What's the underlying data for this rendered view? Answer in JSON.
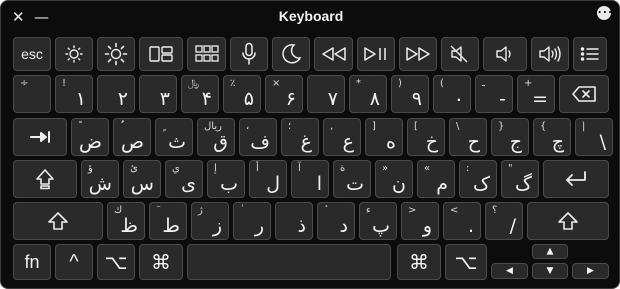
{
  "window": {
    "title": "Keyboard",
    "close_glyph": "✕",
    "minimize_glyph": "—",
    "options_glyph": "⋯"
  },
  "row0": [
    {
      "name": "esc-key",
      "label": "esc"
    },
    {
      "name": "brightness-down-key",
      "icon": "brightness-down-icon"
    },
    {
      "name": "brightness-up-key",
      "icon": "brightness-up-icon"
    },
    {
      "name": "mission-control-key",
      "icon": "mission-control-icon"
    },
    {
      "name": "launchpad-key",
      "icon": "launchpad-icon"
    },
    {
      "name": "dictation-key",
      "icon": "microphone-icon"
    },
    {
      "name": "do-not-disturb-key",
      "icon": "moon-icon"
    },
    {
      "name": "rewind-key",
      "icon": "rewind-icon"
    },
    {
      "name": "play-pause-key",
      "icon": "play-pause-icon"
    },
    {
      "name": "fast-forward-key",
      "icon": "fast-forward-icon"
    },
    {
      "name": "mute-key",
      "icon": "mute-icon"
    },
    {
      "name": "volume-down-key",
      "icon": "volume-down-icon"
    },
    {
      "name": "volume-up-key",
      "icon": "volume-up-icon"
    },
    {
      "name": "list-key",
      "icon": "list-icon"
    }
  ],
  "row1": [
    {
      "shift": "÷",
      "main": ""
    },
    {
      "shift": "!",
      "main": "١"
    },
    {
      "shift": "",
      "main": "٢"
    },
    {
      "shift": "",
      "main": "٣"
    },
    {
      "shift": "﷼",
      "main": "۴"
    },
    {
      "shift": "٪",
      "main": "۵"
    },
    {
      "shift": "×",
      "main": "۶"
    },
    {
      "shift": "",
      "main": "۷"
    },
    {
      "shift": "*",
      "main": "۸"
    },
    {
      "shift": ")",
      "main": "۹"
    },
    {
      "shift": "(",
      "main": "۰"
    },
    {
      "shift": "ـ",
      "main": "-"
    },
    {
      "shift": "+",
      "main": "="
    }
  ],
  "row2": [
    {
      "shift": "ً",
      "main": "ض"
    },
    {
      "shift": "ٌ",
      "main": "ص"
    },
    {
      "shift": "ٍ",
      "main": "ث"
    },
    {
      "shift": "ريال",
      "main": "ق"
    },
    {
      "shift": "،",
      "main": "ف"
    },
    {
      "shift": "؛",
      "main": "غ"
    },
    {
      "shift": ",",
      "main": "ع"
    },
    {
      "shift": "]",
      "main": "ه"
    },
    {
      "shift": "[",
      "main": "خ"
    },
    {
      "shift": "\\",
      "main": "ح"
    },
    {
      "shift": "}",
      "main": "ج"
    },
    {
      "shift": "{",
      "main": "چ"
    },
    {
      "shift": "|",
      "main": "\\"
    }
  ],
  "row3": [
    {
      "shift": "ؤ",
      "main": "ش"
    },
    {
      "shift": "ئ",
      "main": "س"
    },
    {
      "shift": "ي",
      "main": "ی"
    },
    {
      "shift": "إ",
      "main": "ب"
    },
    {
      "shift": "أ",
      "main": "ل"
    },
    {
      "shift": "آ",
      "main": "ا"
    },
    {
      "shift": "ة",
      "main": "ت"
    },
    {
      "shift": "»",
      "main": "ن"
    },
    {
      "shift": "«",
      "main": "م"
    },
    {
      "shift": ":",
      "main": "ک"
    },
    {
      "shift": "\"",
      "main": "گ"
    }
  ],
  "row4": [
    {
      "shift": "ك",
      "main": "ظ"
    },
    {
      "shift": "ٓ",
      "main": "ط"
    },
    {
      "shift": "ژ",
      "main": "ز"
    },
    {
      "shift": "ٰ",
      "main": "ر"
    },
    {
      "shift": "‌",
      "main": "ذ"
    },
    {
      "shift": "ٔ",
      "main": "د"
    },
    {
      "shift": "ء",
      "main": "پ"
    },
    {
      "shift": ">",
      "main": "و"
    },
    {
      "shift": "<",
      "main": "."
    },
    {
      "shift": "؟",
      "main": "/"
    }
  ],
  "mods": {
    "fn": "fn",
    "control": "^",
    "option": "⌥",
    "command": "⌘",
    "command_r": "⌘",
    "option_r": "⌥",
    "up": "▲",
    "left": "◀",
    "down": "▼",
    "right": "▶"
  }
}
